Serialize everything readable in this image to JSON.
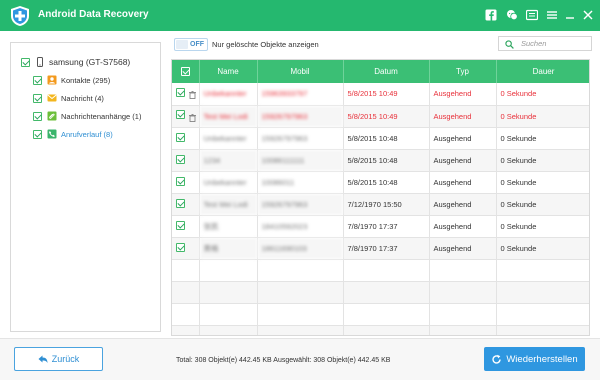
{
  "app": {
    "title": "Android Data Recovery",
    "accent": "#25b86f",
    "titlebar_icons": [
      "facebook-icon",
      "chat-icon",
      "cart-icon",
      "menu-icon",
      "minimize-icon",
      "close-icon"
    ]
  },
  "sidebar": {
    "device_label": "samsung (GT-S7568)",
    "items": [
      {
        "label": "Kontakte (295)",
        "icon": "contacts-icon"
      },
      {
        "label": "Nachricht (4)",
        "icon": "message-icon"
      },
      {
        "label": "Nachrichtenanhänge (1)",
        "icon": "attachment-icon"
      },
      {
        "label": "Anrufverlauf (8)",
        "icon": "phone-icon",
        "selected": true
      }
    ]
  },
  "toolbar": {
    "toggle_state": "OFF",
    "toggle_label": "Nur gelöschte Objekte anzeigen",
    "search_placeholder": "Suchen"
  },
  "table": {
    "columns": [
      "Name",
      "Mobil",
      "Datum",
      "Typ",
      "Dauer"
    ],
    "rows": [
      {
        "deleted": true,
        "name": "Unbekannter",
        "mobil": "15963933797",
        "datum": "5/8/2015 10:49",
        "typ": "Ausgehend",
        "dauer": "0 Sekunde"
      },
      {
        "deleted": true,
        "name": "Test Mei Lodi",
        "mobil": "15926797963",
        "datum": "5/8/2015 10:49",
        "typ": "Ausgehend",
        "dauer": "0 Sekunde"
      },
      {
        "deleted": false,
        "name": "Unbekannter",
        "mobil": "15926797963",
        "datum": "5/8/2015 10:48",
        "typ": "Ausgehend",
        "dauer": "0 Sekunde"
      },
      {
        "deleted": false,
        "name": "1234",
        "mobil": "10086111111",
        "datum": "5/8/2015 10:48",
        "typ": "Ausgehend",
        "dauer": "0 Sekunde"
      },
      {
        "deleted": false,
        "name": "Unbekannter",
        "mobil": "10086011",
        "datum": "5/8/2015 10:48",
        "typ": "Ausgehend",
        "dauer": "0 Sekunde"
      },
      {
        "deleted": false,
        "name": "Test Mei Lodi",
        "mobil": "15926797963",
        "datum": "7/12/1970 15:50",
        "typ": "Ausgehend",
        "dauer": "0 Sekunde"
      },
      {
        "deleted": false,
        "name": "张凯",
        "mobil": "18410592023",
        "datum": "7/8/1970 17:37",
        "typ": "Ausgehend",
        "dauer": "0 Sekunde"
      },
      {
        "deleted": false,
        "name": "黄格",
        "mobil": "18611690103",
        "datum": "7/8/1970 17:37",
        "typ": "Ausgehend",
        "dauer": "0 Sekunde"
      }
    ],
    "empty_rows": 4
  },
  "footer": {
    "back_label": "Zurück",
    "summary": "Total: 308 Objekt(e) 442.45 KB   Ausgewählt: 308 Objekt(e) 442.45 KB",
    "restore_label": "Wiederherstellen"
  }
}
